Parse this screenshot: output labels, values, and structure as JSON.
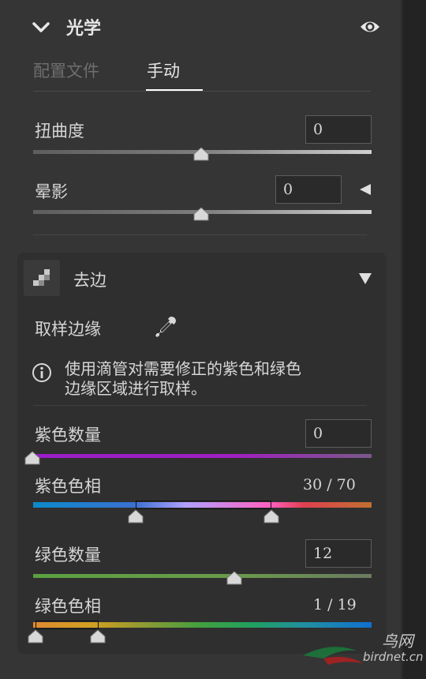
{
  "header": {
    "title": "光学",
    "chevron_icon": "chevron-down-icon",
    "visibility_icon": "eye-icon"
  },
  "tabs": [
    {
      "label": "配置文件",
      "active": false
    },
    {
      "label": "手动",
      "active": true
    }
  ],
  "distortion": {
    "label": "扭曲度",
    "value": "0",
    "level": 0.5
  },
  "vignette": {
    "label": "晕影",
    "value": "0",
    "level": 0.5,
    "expand_icon": "triangle-left-icon"
  },
  "defringe": {
    "title": "去边",
    "icon": "defringe-grid-icon",
    "collapse_icon": "triangle-down-icon",
    "sample_label": "取样边缘",
    "eyedropper_icon": "eyedropper-icon",
    "info_icon": "info-icon",
    "info_line1": "使用滴管对需要修正的紫色和绿色",
    "info_line2": "边缘区域进行取样。",
    "purple_amount": {
      "label": "紫色数量",
      "value": "0",
      "level": 0
    },
    "purple_hue": {
      "label": "紫色色相",
      "range_text": "30 / 70",
      "low": 30,
      "high": 70
    },
    "green_amount": {
      "label": "绿色数量",
      "value": "12",
      "level": 0.6
    },
    "green_hue": {
      "label": "绿色色相",
      "range_text": "1 / 19",
      "low": 1,
      "high": 19
    }
  },
  "watermark": {
    "brand": "鸟网",
    "site": "birdnet.cn"
  },
  "colors": {
    "panel_bg": "#353535",
    "section_bg": "#2f2f2f",
    "tab_underline": "#ffffff",
    "purple_track": "#a020c0",
    "green_track": "#6a9a4a"
  }
}
